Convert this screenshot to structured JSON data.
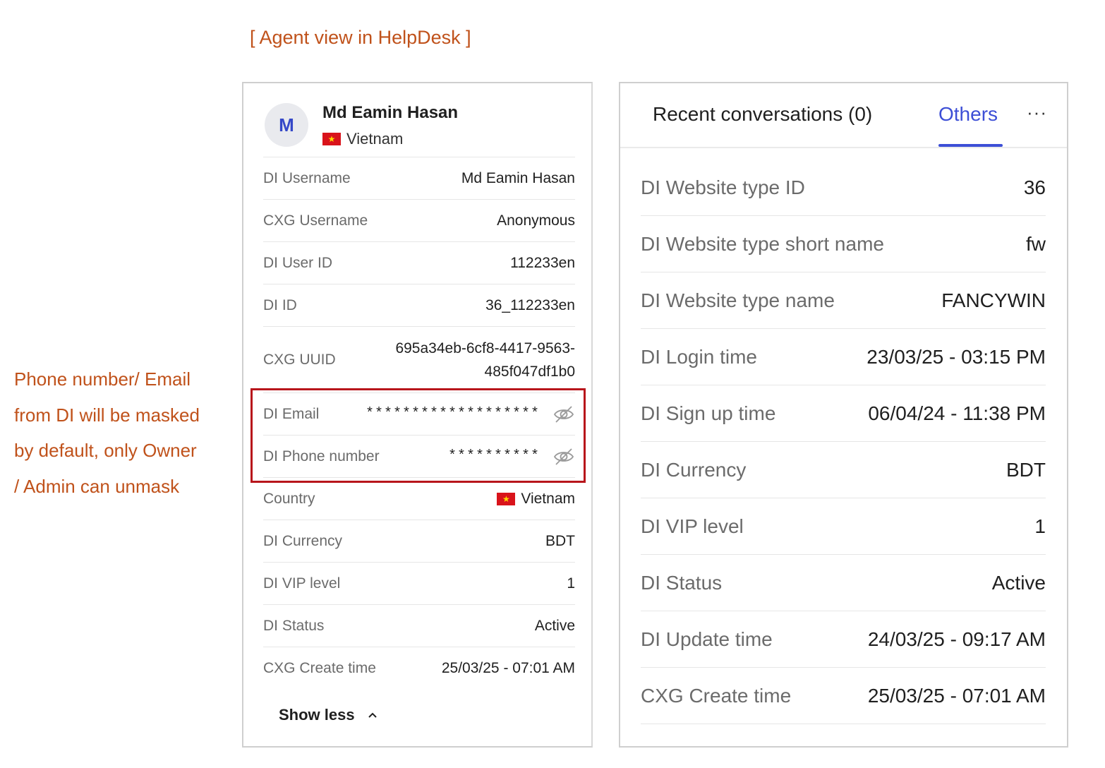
{
  "top_caption": "[ Agent view in HelpDesk ]",
  "side_note": {
    "lines": [
      "Phone number/ Email",
      "from DI will be masked",
      "by default, only Owner",
      "/ Admin can unmask"
    ]
  },
  "profile": {
    "avatar_initial": "M",
    "name": "Md Eamin Hasan",
    "country": "Vietnam",
    "flag_icon": "vietnam-flag-icon"
  },
  "left_rows": [
    {
      "label": "DI Username",
      "value": "Md Eamin Hasan"
    },
    {
      "label": "CXG Username",
      "value": "Anonymous"
    },
    {
      "label": "DI User ID",
      "value": "112233en"
    },
    {
      "label": "DI ID",
      "value": "36_112233en"
    },
    {
      "label": "CXG UUID",
      "value": "695a34eb-6cf8-4417-9563-485f047df1b0"
    },
    {
      "label": "DI Email",
      "value": "*******************"
    },
    {
      "label": "DI Phone number",
      "value": "**********"
    },
    {
      "label": "Country",
      "value": "Vietnam"
    },
    {
      "label": "DI Currency",
      "value": "BDT"
    },
    {
      "label": "DI VIP level",
      "value": "1"
    },
    {
      "label": "DI Status",
      "value": "Active"
    },
    {
      "label": "CXG Create time",
      "value": "25/03/25 - 07:01 AM"
    }
  ],
  "show_less_label": "Show less",
  "highlight_color": "#b8151b",
  "accent_color": "#3d4fd6",
  "tabs": {
    "recent": "Recent conversations (0)",
    "others": "Others",
    "more": "···"
  },
  "right_rows": [
    {
      "label": "DI Website type ID",
      "value": "36"
    },
    {
      "label": "DI Website type short name",
      "value": "fw"
    },
    {
      "label": "DI Website type name",
      "value": "FANCYWIN"
    },
    {
      "label": "DI Login time",
      "value": "23/03/25 - 03:15 PM"
    },
    {
      "label": "DI Sign up time",
      "value": "06/04/24 - 11:38 PM"
    },
    {
      "label": "DI Currency",
      "value": "BDT"
    },
    {
      "label": "DI VIP level",
      "value": "1"
    },
    {
      "label": "DI Status",
      "value": "Active"
    },
    {
      "label": "DI Update time",
      "value": "24/03/25 - 09:17 AM"
    },
    {
      "label": "CXG Create time",
      "value": "25/03/25 - 07:01 AM"
    }
  ]
}
